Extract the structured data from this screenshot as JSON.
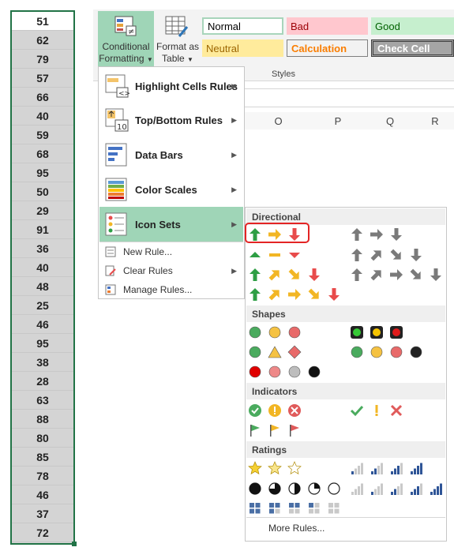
{
  "column_values": [
    "51",
    "62",
    "79",
    "57",
    "66",
    "40",
    "59",
    "68",
    "95",
    "50",
    "29",
    "91",
    "36",
    "40",
    "48",
    "25",
    "46",
    "95",
    "38",
    "28",
    "63",
    "88",
    "80",
    "85",
    "78",
    "46",
    "37",
    "72"
  ],
  "ribbon": {
    "conditional_formatting_line1": "Conditional",
    "conditional_formatting_line2": "Formatting",
    "format_as_table_line1": "Format as",
    "format_as_table_line2": "Table",
    "styles_group_label": "Styles",
    "styles": {
      "normal": "Normal",
      "bad": "Bad",
      "good": "Good",
      "neutral": "Neutral",
      "calculation": "Calculation",
      "check_cell": "Check Cell"
    }
  },
  "columns": [
    "O",
    "P",
    "Q",
    "R"
  ],
  "menu": {
    "items": [
      {
        "label": "Highlight Cells Rules"
      },
      {
        "label": "Top/Bottom Rules"
      },
      {
        "label": "Data Bars"
      },
      {
        "label": "Color Scales"
      },
      {
        "label": "Icon Sets"
      }
    ],
    "top_bottom_icon_text": "10",
    "small_items": [
      {
        "label": "New Rule..."
      },
      {
        "label": "Clear Rules"
      },
      {
        "label": "Manage Rules..."
      }
    ]
  },
  "submenu": {
    "sections": [
      "Directional",
      "Shapes",
      "Indicators",
      "Ratings"
    ],
    "more_rules": "More Rules..."
  },
  "colors": {
    "accent_green": "#217346",
    "selected_green": "#9fd5b7",
    "arrow_green": "#2e9e44",
    "arrow_yellow": "#f2b624",
    "arrow_red": "#e84b4b",
    "arrow_gray": "#7a7a7a",
    "highlight_red": "#e32424"
  }
}
